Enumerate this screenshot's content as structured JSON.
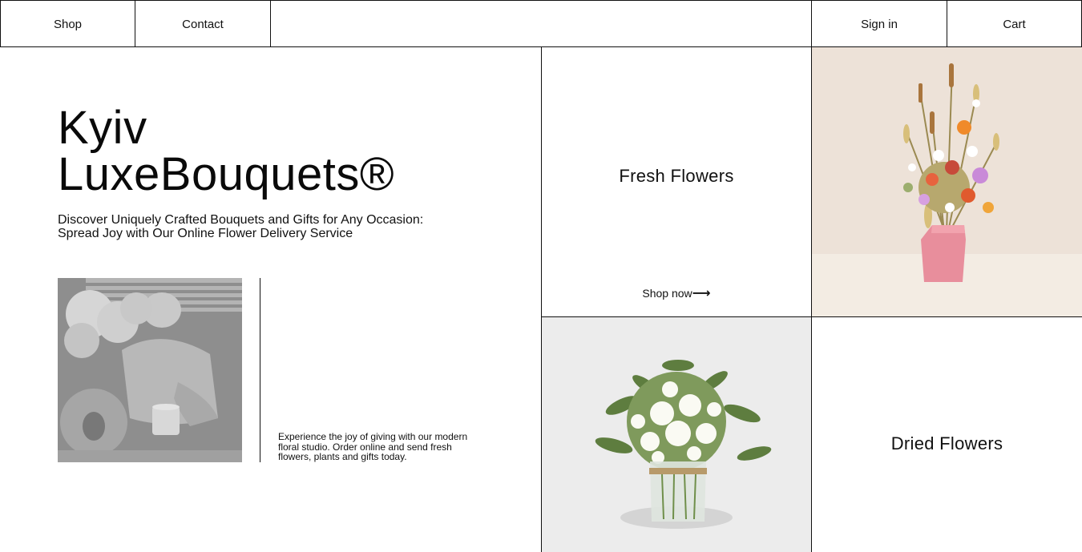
{
  "nav": {
    "shop": "Shop",
    "contact": "Contact",
    "sign_in": "Sign in",
    "cart": "Cart"
  },
  "hero": {
    "title_line1": "Kyiv",
    "title_line2": "LuxeBouquets®",
    "subtitle_line1": "Discover Uniquely Crafted Bouquets and Gifts for Any Occasion:",
    "subtitle_line2": "Spread Joy with Our Online Flower Delivery Service",
    "description": "Experience the joy of giving with our modern floral studio. Order online and send fresh flowers, plants and gifts today."
  },
  "categories": {
    "fresh": {
      "title": "Fresh Flowers",
      "cta": "Shop now",
      "cta_arrow": "⟶"
    },
    "dried": {
      "title": "Dried Flowers"
    }
  },
  "colors": {
    "border": "#111111",
    "beige_background": "#ede2d8",
    "vase_pink": "#e88e9c"
  }
}
